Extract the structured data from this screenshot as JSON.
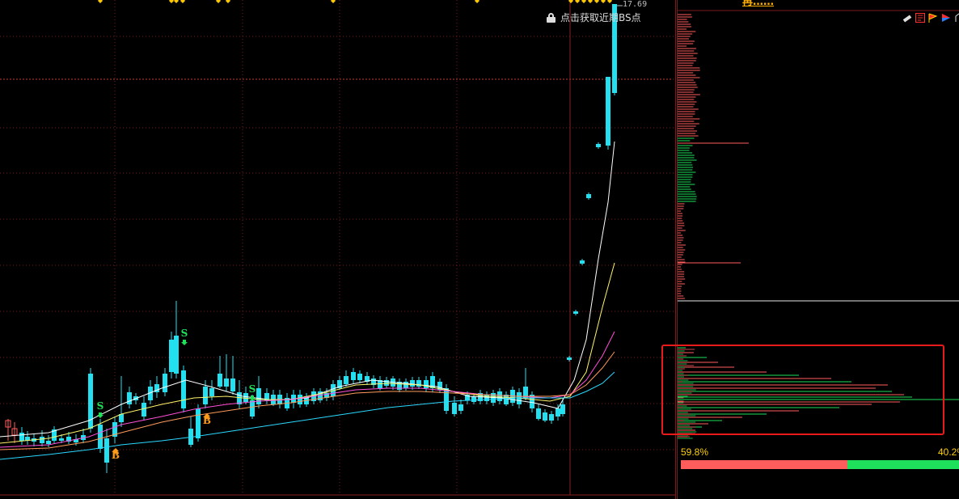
{
  "header": {
    "price_top": "17.69",
    "lock_hint": "点击获取近期BS点",
    "banner": "再……"
  },
  "icons": {
    "lock": "lock-icon",
    "toolbar": [
      "eraser-icon",
      "notes-icon",
      "flag-icon",
      "color-flag-icon",
      "more-icon"
    ]
  },
  "signals": {
    "sell": "S",
    "buy": "B"
  },
  "ratio": {
    "left_label": "59.8%",
    "right_label": "40.2%",
    "left": 0.598,
    "right": 0.402
  },
  "colors": {
    "up": "#ff5c5c",
    "down": "#22e0ef",
    "profit": "#1ee05a",
    "signal_s": "#1ee05a",
    "signal_b": "#ff9b1a",
    "grid": "#7a1a1a",
    "highlight": "#e81a1a"
  }
}
